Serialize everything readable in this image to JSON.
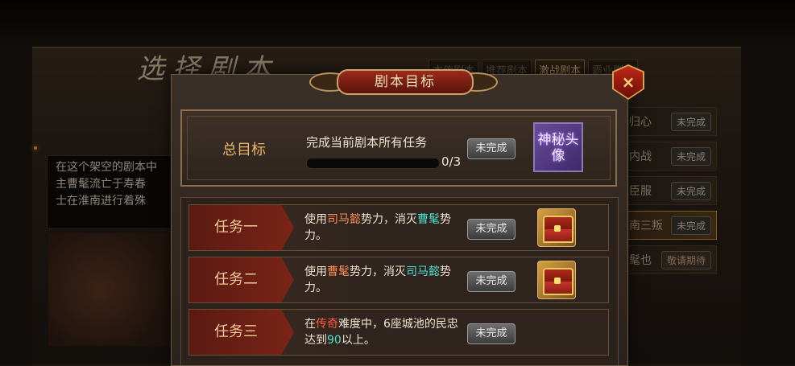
{
  "background": {
    "title": "选择剧本",
    "tabs": [
      {
        "label": "本传剧本",
        "active": false
      },
      {
        "label": "推荐剧本",
        "active": false
      },
      {
        "label": "激战剧本",
        "active": true
      },
      {
        "label": "霸业剧本",
        "active": false
      }
    ],
    "description_lines": [
      "在这个架空的剧本中",
      "主曹髦流亡于寿春",
      "士在淮南进行着殊"
    ],
    "scenario_list": [
      {
        "name": "东归心",
        "status": "未完成"
      },
      {
        "name": "寿内战",
        "status": "未完成"
      },
      {
        "name": "蜀臣服",
        "status": "未完成"
      },
      {
        "name": "淮南三叛",
        "status": "未完成"
      },
      {
        "name": "曹髦也",
        "status": "敬请期待"
      }
    ]
  },
  "modal": {
    "title": "剧本目标",
    "close_label": "×",
    "total": {
      "label": "总目标",
      "description": "完成当前剧本所有任务",
      "progress_text": "0/3",
      "progress_fraction": 0,
      "status": "未完成",
      "reward_text": "神秘头像"
    },
    "tasks": [
      {
        "label": "任务一",
        "desc_parts": [
          {
            "text": "使用",
            "color": ""
          },
          {
            "text": "司马懿",
            "color": "orange"
          },
          {
            "text": "势力，消灭",
            "color": ""
          },
          {
            "text": "曹髦",
            "color": "teal"
          },
          {
            "text": "势力。",
            "color": ""
          }
        ],
        "status": "未完成",
        "reward": "chest-icon"
      },
      {
        "label": "任务二",
        "desc_parts": [
          {
            "text": "使用",
            "color": ""
          },
          {
            "text": "曹髦",
            "color": "orange"
          },
          {
            "text": "势力，消灭",
            "color": ""
          },
          {
            "text": "司马懿",
            "color": "teal"
          },
          {
            "text": "势力。",
            "color": ""
          }
        ],
        "status": "未完成",
        "reward": "chest-icon"
      },
      {
        "label": "任务三",
        "desc_parts": [
          {
            "text": "在",
            "color": ""
          },
          {
            "text": "传奇",
            "color": "red"
          },
          {
            "text": "难度中，6座城池的民忠达到",
            "color": ""
          },
          {
            "text": "90",
            "color": "teal"
          },
          {
            "text": "以上。",
            "color": ""
          }
        ],
        "status": "未完成",
        "reward": ""
      }
    ]
  },
  "colors": {
    "accent_gold": "#c9a466",
    "header_red": "#9a2a1c",
    "highlight_orange": "#ff8c5a",
    "highlight_red": "#ff5a3c",
    "highlight_teal": "#4ee0d0"
  }
}
